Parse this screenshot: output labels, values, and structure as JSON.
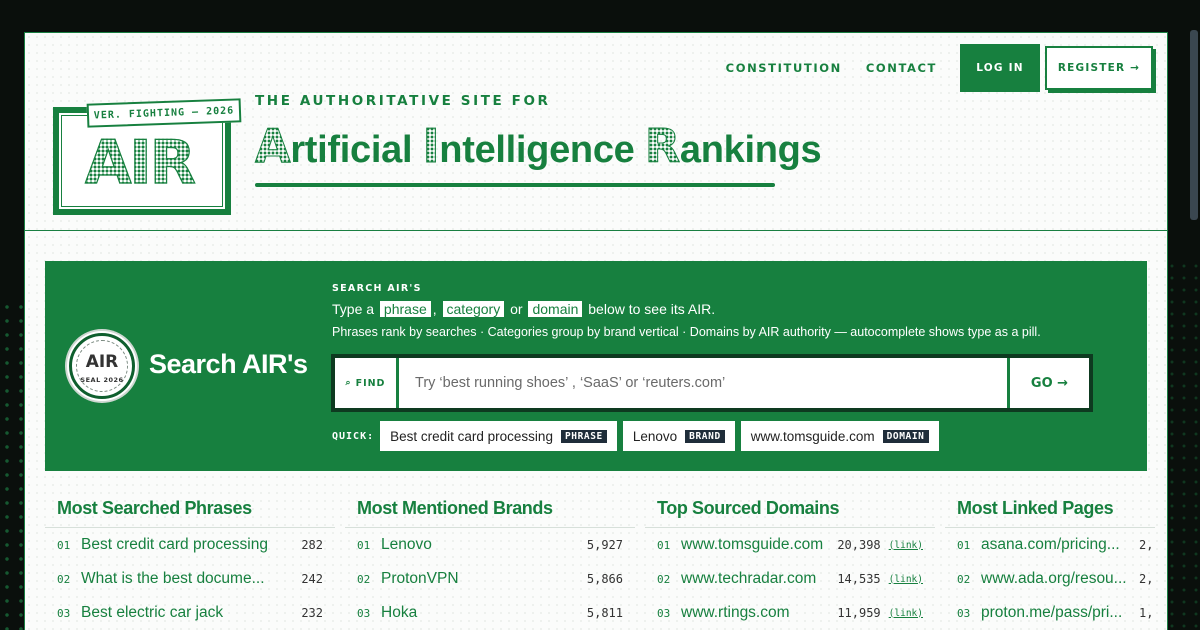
{
  "nav": {
    "constitution": "CONSTITUTION",
    "contact": "CONTACT",
    "login": "LOG IN",
    "register": "REGISTER →"
  },
  "logo": {
    "badge": "VER. FIGHTING — 2026",
    "text": "AIR"
  },
  "header": {
    "tagline": "THE AUTHORITATIVE SITE FOR",
    "title_parts": [
      {
        "cap": "A",
        "rest": "rtificial "
      },
      {
        "cap": "I",
        "rest": "ntelligence "
      },
      {
        "cap": "R",
        "rest": "ankings"
      }
    ]
  },
  "search": {
    "seal_text": "AIR",
    "seal_sub": "SEAL 2026",
    "panel_title": "Search AIR's",
    "label": "SEARCH AIR'S",
    "intro_prefix": "Type a",
    "pill_phrase": "phrase",
    "sep1": ",",
    "pill_category": "category",
    "sep2": "or",
    "pill_domain": "domain",
    "intro_suffix": "below to see its AIR.",
    "help": "Phrases rank by searches · Categories group by brand vertical · Domains by AIR authority — autocomplete shows type as a pill.",
    "find_label": "FIND",
    "placeholder": "Try ‘best running shoes’ , ‘SaaS’ or ‘reuters.com’",
    "go_label": "GO →",
    "quick_label": "QUICK:",
    "quick_chips": [
      {
        "text": "Best credit card processing",
        "type": "PHRASE"
      },
      {
        "text": "Lenovo",
        "type": "BRAND"
      },
      {
        "text": "www.tomsguide.com",
        "type": "DOMAIN"
      }
    ]
  },
  "lists": [
    {
      "title": "Most Searched Phrases",
      "rows": [
        {
          "rank": "01",
          "name": "Best credit card processing",
          "count": "282"
        },
        {
          "rank": "02",
          "name": "What is the best docume...",
          "count": "242"
        },
        {
          "rank": "03",
          "name": "Best electric car jack",
          "count": "232"
        }
      ]
    },
    {
      "title": "Most Mentioned Brands",
      "rows": [
        {
          "rank": "01",
          "name": "Lenovo",
          "count": "5,927"
        },
        {
          "rank": "02",
          "name": "ProtonVPN",
          "count": "5,866"
        },
        {
          "rank": "03",
          "name": "Hoka",
          "count": "5,811"
        }
      ]
    },
    {
      "title": "Top Sourced Domains",
      "rows": [
        {
          "rank": "01",
          "name": "www.tomsguide.com",
          "count": "20,398",
          "link": "(link)"
        },
        {
          "rank": "02",
          "name": "www.techradar.com",
          "count": "14,535",
          "link": "(link)"
        },
        {
          "rank": "03",
          "name": "www.rtings.com",
          "count": "11,959",
          "link": "(link)"
        }
      ]
    },
    {
      "title": "Most Linked Pages",
      "rows": [
        {
          "rank": "01",
          "name": "asana.com/pricing...",
          "count": "2,"
        },
        {
          "rank": "02",
          "name": "www.ada.org/resou...",
          "count": "2,"
        },
        {
          "rank": "03",
          "name": "proton.me/pass/pri...",
          "count": "1,"
        }
      ]
    }
  ]
}
